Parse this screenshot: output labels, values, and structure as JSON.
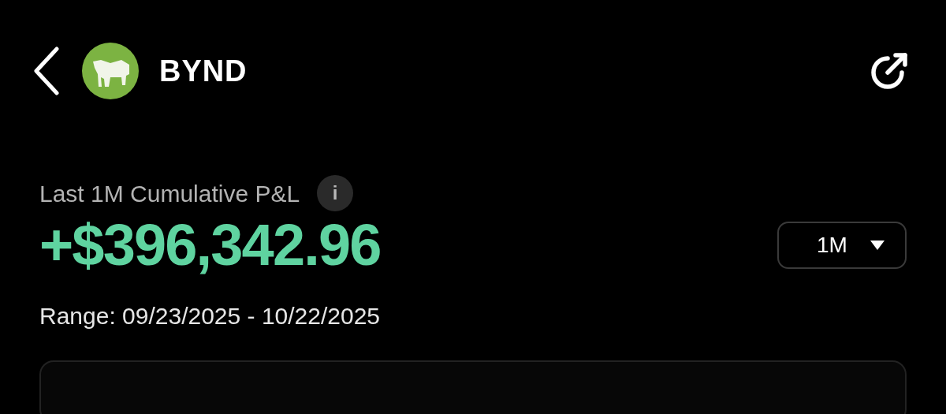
{
  "header": {
    "ticker": "BYND"
  },
  "summary": {
    "label": "Last 1M Cumulative P&L",
    "info_icon": "i",
    "value": "+$396,342.96",
    "period": "1M",
    "range": "Range: 09/23/2025 - 10/22/2025"
  }
}
